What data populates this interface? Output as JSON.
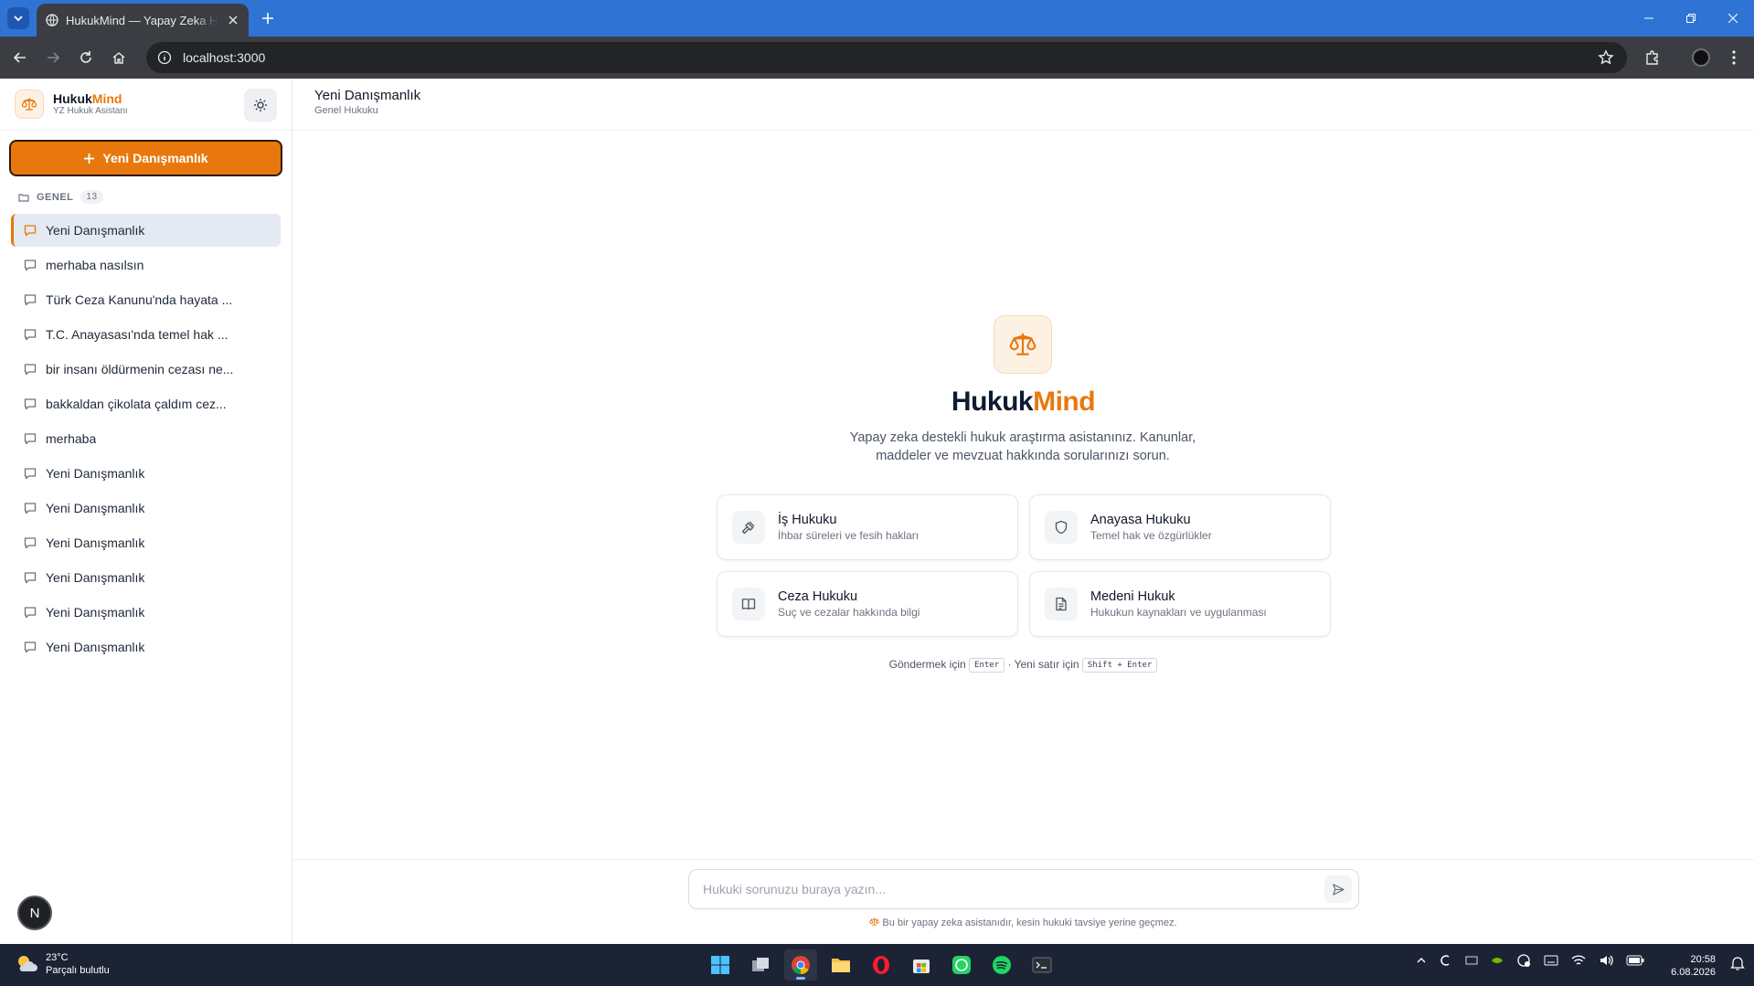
{
  "browser": {
    "tab_title": "HukukMind — Yapay Zeka Hukuk Asistanı",
    "url": "localhost:3000"
  },
  "sidebar": {
    "brand_part1": "Hukuk",
    "brand_part2": "Mind",
    "brand_sub": "YZ Hukuk Asistanı",
    "new_button": "Yeni Danışmanlık",
    "group_label": "GENEL",
    "group_count": "13",
    "conversations": [
      "Yeni Danışmanlık",
      "merhaba nasılsın",
      "Türk Ceza Kanunu'nda hayata ...",
      "T.C. Anayasası'nda temel hak ...",
      "bir insanı öldürmenin cezası ne...",
      "bakkaldan çikolata çaldım cez...",
      "merhaba",
      "Yeni Danışmanlık",
      "Yeni Danışmanlık",
      "Yeni Danışmanlık",
      "Yeni Danışmanlık",
      "Yeni Danışmanlık",
      "Yeni Danışmanlık"
    ],
    "avatar_initial": "N"
  },
  "main": {
    "title": "Yeni Danışmanlık",
    "subtitle": "Genel Hukuku",
    "hero_part1": "Hukuk",
    "hero_part2": "Mind",
    "hero_desc": "Yapay zeka destekli hukuk araştırma asistanınız. Kanunlar, maddeler ve mevzuat hakkında sorularınızı sorun.",
    "cards": [
      {
        "title": "İş Hukuku",
        "sub": "İhbar süreleri ve fesih hakları",
        "icon": "gavel-icon"
      },
      {
        "title": "Anayasa Hukuku",
        "sub": "Temel hak ve özgürlükler",
        "icon": "shield-icon"
      },
      {
        "title": "Ceza Hukuku",
        "sub": "Suç ve cezalar hakkında bilgi",
        "icon": "book-icon"
      },
      {
        "title": "Medeni Hukuk",
        "sub": "Hukukun kaynakları ve uygulanması",
        "icon": "document-icon"
      }
    ],
    "hint_send": "Göndermek için",
    "hint_enter": "Enter",
    "hint_sep": " · ",
    "hint_newline": "Yeni satır için",
    "hint_shift": "Shift + Enter",
    "input_placeholder": "Hukuki sorunuzu buraya yazın...",
    "disclaimer": "Bu bir yapay zeka asistanıdır, kesin hukuki tavsiye yerine geçmez."
  },
  "taskbar": {
    "temp": "23°C",
    "weather": "Parçalı bulutlu",
    "time": "20:58",
    "date": "6.08.2026"
  },
  "colors": {
    "accent": "#e8780e",
    "tabstrip": "#2f73d4",
    "taskbar": "#1b2335"
  }
}
